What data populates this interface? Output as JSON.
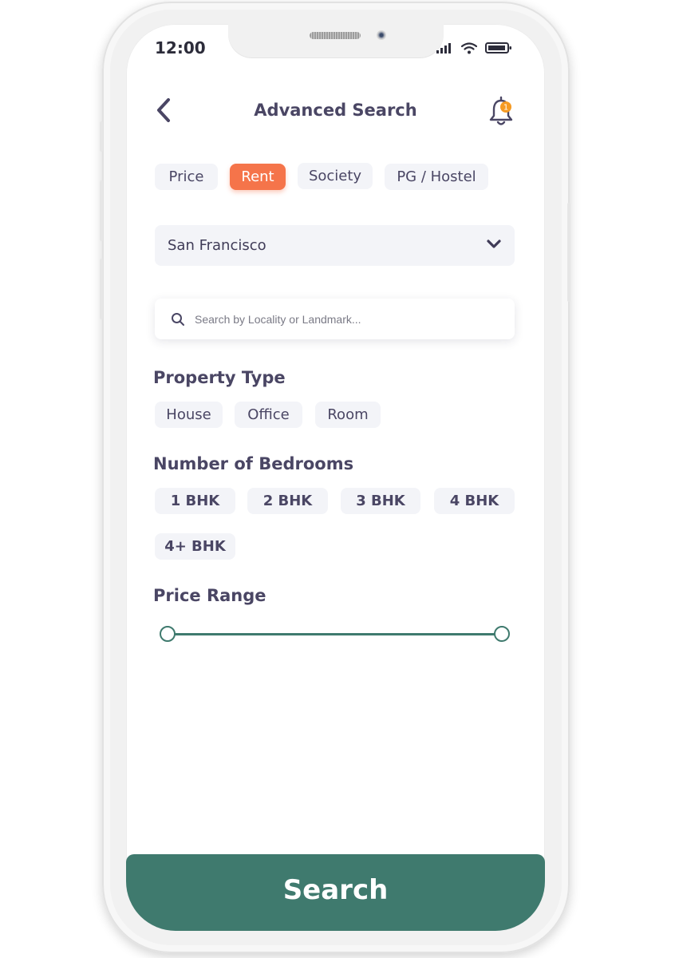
{
  "status": {
    "time": "12:00"
  },
  "header": {
    "title": "Advanced Search",
    "notification_count": "1"
  },
  "tabs": [
    {
      "label": "Price",
      "active": false
    },
    {
      "label": "Rent",
      "active": true
    },
    {
      "label": "Society",
      "active": false
    },
    {
      "label": "PG / Hostel",
      "active": false
    }
  ],
  "city": {
    "selected": "San Francisco"
  },
  "search": {
    "placeholder": "Search by Locality or Landmark..."
  },
  "property_type": {
    "title": "Property Type",
    "options": [
      "House",
      "Office",
      "Room"
    ]
  },
  "bedrooms": {
    "title": "Number of Bedrooms",
    "options": [
      "1 BHK",
      "2 BHK",
      "3 BHK",
      "4 BHK",
      "4+ BHK"
    ]
  },
  "price_range": {
    "title": "Price Range",
    "min_fraction": 0,
    "max_fraction": 1
  },
  "action": {
    "search_label": "Search"
  },
  "colors": {
    "accent": "#f5744a",
    "primary": "#3f7a6e",
    "text": "#4a4664",
    "chip_bg": "#f3f4f8",
    "badge": "#f59a23"
  },
  "icons": [
    "back-chevron-icon",
    "bell-icon",
    "chevron-down-icon",
    "search-icon",
    "signal-icon",
    "wifi-icon",
    "battery-icon"
  ]
}
